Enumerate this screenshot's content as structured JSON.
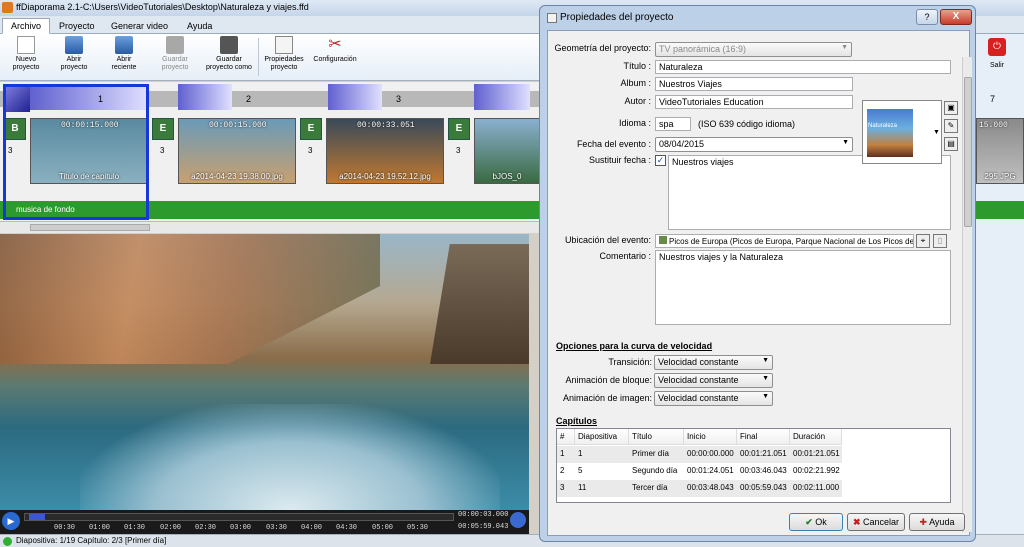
{
  "app": {
    "title": "ffDiaporama 2.1-C:\\Users\\VideoTutoriales\\Desktop\\Naturaleza y viajes.ffd"
  },
  "tabs": [
    "Archivo",
    "Proyecto",
    "Generar video",
    "Ayuda"
  ],
  "ribbon": {
    "nuevo": "Nuevo proyecto",
    "abrir": "Abrir proyecto",
    "reciente": "Abrir reciente",
    "guardar": "Guardar proyecto",
    "guardar_como": "Guardar proyecto como",
    "propiedades": "Propiedades proyecto",
    "config": "Configuración",
    "salir": "Salir"
  },
  "timeline": {
    "slide_numbers": [
      "1",
      "2",
      "3",
      "7"
    ],
    "slides": [
      {
        "duration": "00:00:15.000",
        "caption": "Titulo de capitulo",
        "index": "3"
      },
      {
        "duration": "00:00:15.000",
        "caption": "a2014-04-23 19.38.00.jpg",
        "index": "3"
      },
      {
        "duration": "00:00:33.051",
        "caption": "a2014-04-23 19.52.12.jpg",
        "index": "3"
      },
      {
        "duration": "",
        "caption": "bJOS_0",
        "index": "3"
      },
      {
        "duration": "15.000",
        "caption": "295.JPG",
        "index": ""
      }
    ],
    "music_label": "musica de fondo"
  },
  "player": {
    "ticks": [
      "00:30",
      "01:00",
      "01:30",
      "02:00",
      "02:30",
      "03:00",
      "03:30",
      "04:00",
      "04:30",
      "05:00",
      "05:30"
    ],
    "current_time": "00:00:03.000",
    "total_time": "00:05:59.043"
  },
  "status": {
    "text": "Diapositiva: 1/19   Capítulo: 2/3 [Primer día]"
  },
  "dialog": {
    "title": "Propiedades del proyecto",
    "help": "?",
    "close": "X",
    "labels": {
      "geometria": "Geometría del proyecto:",
      "titulo": "Título :",
      "album": "Album :",
      "autor": "Autor :",
      "idioma": "Idioma :",
      "fecha": "Fecha del evento :",
      "sustituir": "Sustituir fecha :",
      "ubicacion": "Ubicación del evento:",
      "comentario": "Comentario :"
    },
    "values": {
      "geometria": "TV panorámica (16:9)",
      "titulo": "Naturaleza",
      "album": "Nuestros Viajes",
      "autor": "VideoTutoriales Education",
      "idioma": "spa",
      "idioma_note": "(ISO 639 código idioma)",
      "fecha": "08/04/2015",
      "sustituir": "Nuestros viajes",
      "ubicacion": "Picos de Europa (Picos de Europa, Parque Nacional de Los Picos de",
      "comentario": "Nuestros viajes y la Naturaleza",
      "cover_text": "Naturaleza"
    },
    "speed": {
      "section": "Opciones para la curva de velocidad",
      "labels": [
        "Transición:",
        "Animación de bloque:",
        "Animación de imagen:"
      ],
      "values": [
        "Velocidad constante",
        "Velocidad constante",
        "Velocidad constante"
      ]
    },
    "chapters": {
      "section": "Capítulos",
      "headers": [
        "#",
        "Diapositiva",
        "Título",
        "Inicio",
        "Final",
        "Duración"
      ],
      "rows": [
        [
          "1",
          "1",
          "Primer día",
          "00:00:00.000",
          "00:01:21.051",
          "00:01:21.051"
        ],
        [
          "2",
          "5",
          "Segundo día",
          "00:01:24.051",
          "00:03:46.043",
          "00:02:21.992"
        ],
        [
          "3",
          "11",
          "Tercer día",
          "00:03:48.043",
          "00:05:59.043",
          "00:02:11.000"
        ]
      ]
    },
    "buttons": {
      "ok": "Ok",
      "cancel": "Cancelar",
      "help": "Ayuda"
    }
  }
}
